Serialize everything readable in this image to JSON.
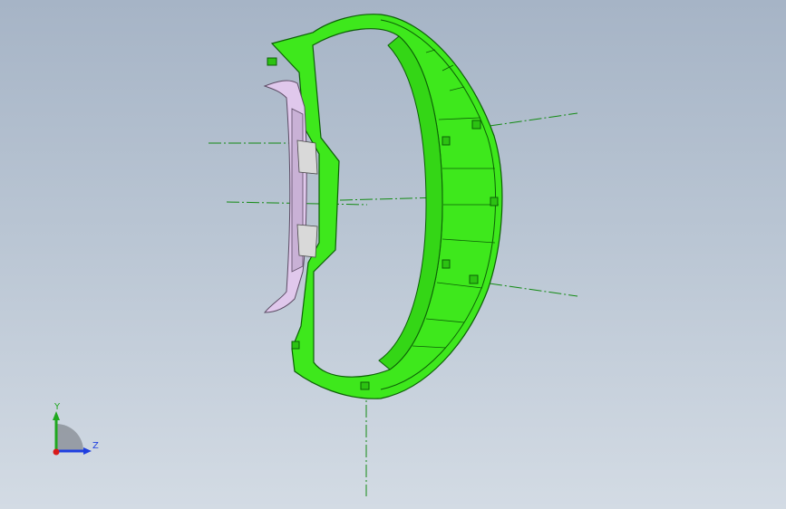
{
  "viewport": {
    "background_top": "#a6b4c6",
    "background_bottom": "#d3dbe4"
  },
  "model": {
    "part_color": "#3ee81c",
    "part_edge_color": "#0c5f06",
    "trim_color": "#e0c8ec",
    "trim_edge_color": "#5b4a63",
    "centerline_color": "#138a13"
  },
  "triad": {
    "y_label": "Y",
    "z_label": "Z",
    "y_color": "#1fa81f",
    "z_color": "#1f3fe0",
    "x_color": "#d81a1a"
  }
}
